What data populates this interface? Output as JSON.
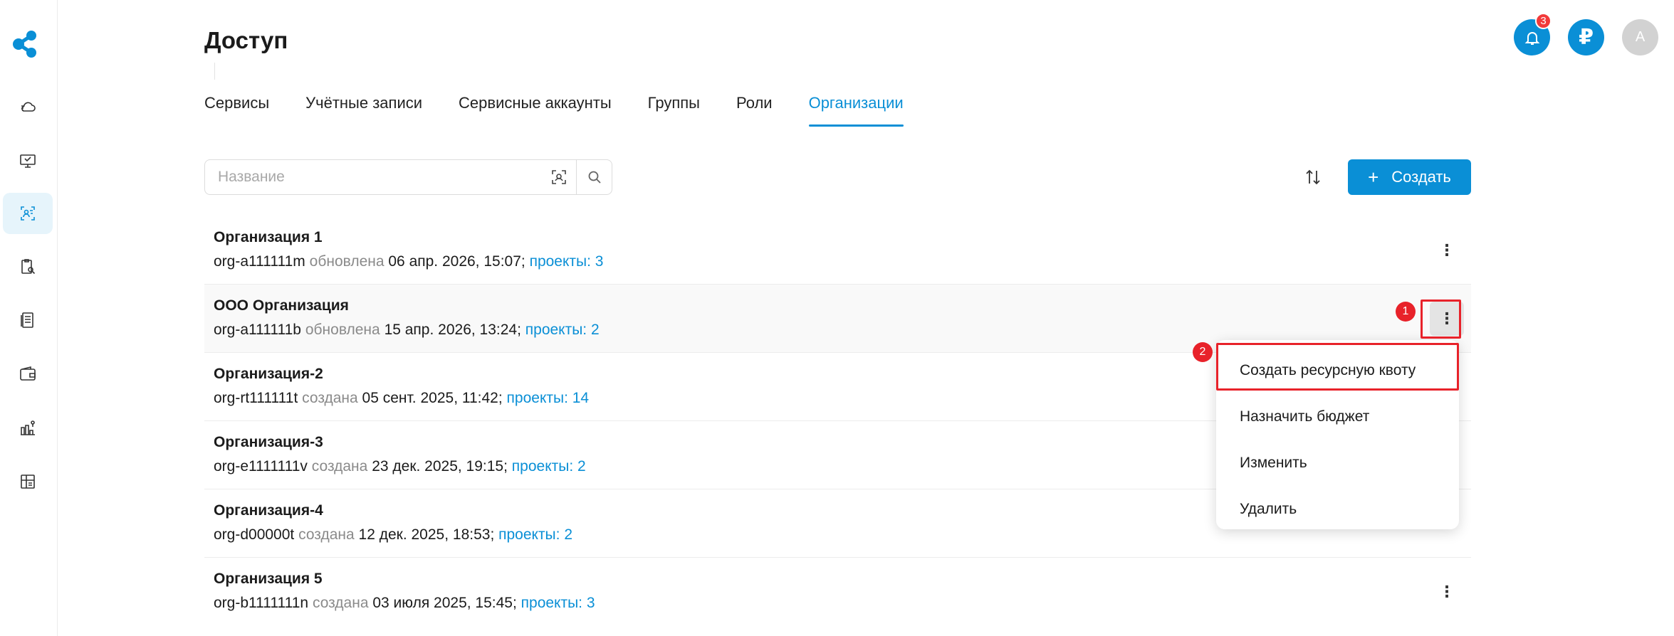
{
  "page": {
    "title": "Доступ"
  },
  "header": {
    "notifications_badge": "3",
    "currency_glyph": "₽",
    "avatar_initial": "A"
  },
  "tabs": [
    {
      "label": "Сервисы",
      "active": false
    },
    {
      "label": "Учётные записи",
      "active": false
    },
    {
      "label": "Сервисные аккаунты",
      "active": false
    },
    {
      "label": "Группы",
      "active": false
    },
    {
      "label": "Роли",
      "active": false
    },
    {
      "label": "Организации",
      "active": true
    }
  ],
  "search": {
    "placeholder": "Название",
    "value": ""
  },
  "toolbar": {
    "create_label": "Создать",
    "create_plus": "+"
  },
  "organizations": [
    {
      "name": "Организация 1",
      "id": "org-a111111m",
      "status": "обновлена",
      "date": "06 апр. 2026, 15:07",
      "projects": "проекты: 3"
    },
    {
      "name": "ООО Организация",
      "id": "org-a111111b",
      "status": "обновлена",
      "date": "15 апр. 2026, 13:24",
      "projects": "проекты: 2"
    },
    {
      "name": "Организация-2",
      "id": "org-rt111111t",
      "status": "создана",
      "date": "05 сент. 2025, 11:42",
      "projects": "проекты: 14"
    },
    {
      "name": "Организация-3",
      "id": "org-e1111111v",
      "status": "создана",
      "date": "23 дек. 2025, 19:15",
      "projects": "проекты: 2"
    },
    {
      "name": "Организация-4",
      "id": "org-d00000t",
      "status": "создана",
      "date": "12 дек. 2025, 18:53",
      "projects": "проекты: 2"
    },
    {
      "name": "Организация 5",
      "id": "org-b1111111n",
      "status": "создана",
      "date": "03 июля 2025, 15:45",
      "projects": "проекты: 3"
    }
  ],
  "context_menu": {
    "items": [
      "Создать ресурсную квоту",
      "Назначить бюджет",
      "Изменить",
      "Удалить"
    ]
  },
  "annotations": {
    "marker_1": "1",
    "marker_2": "2",
    "color": "#e8222a"
  },
  "colors": {
    "accent": "#0a8fd6",
    "badge": "#f23a3a"
  }
}
